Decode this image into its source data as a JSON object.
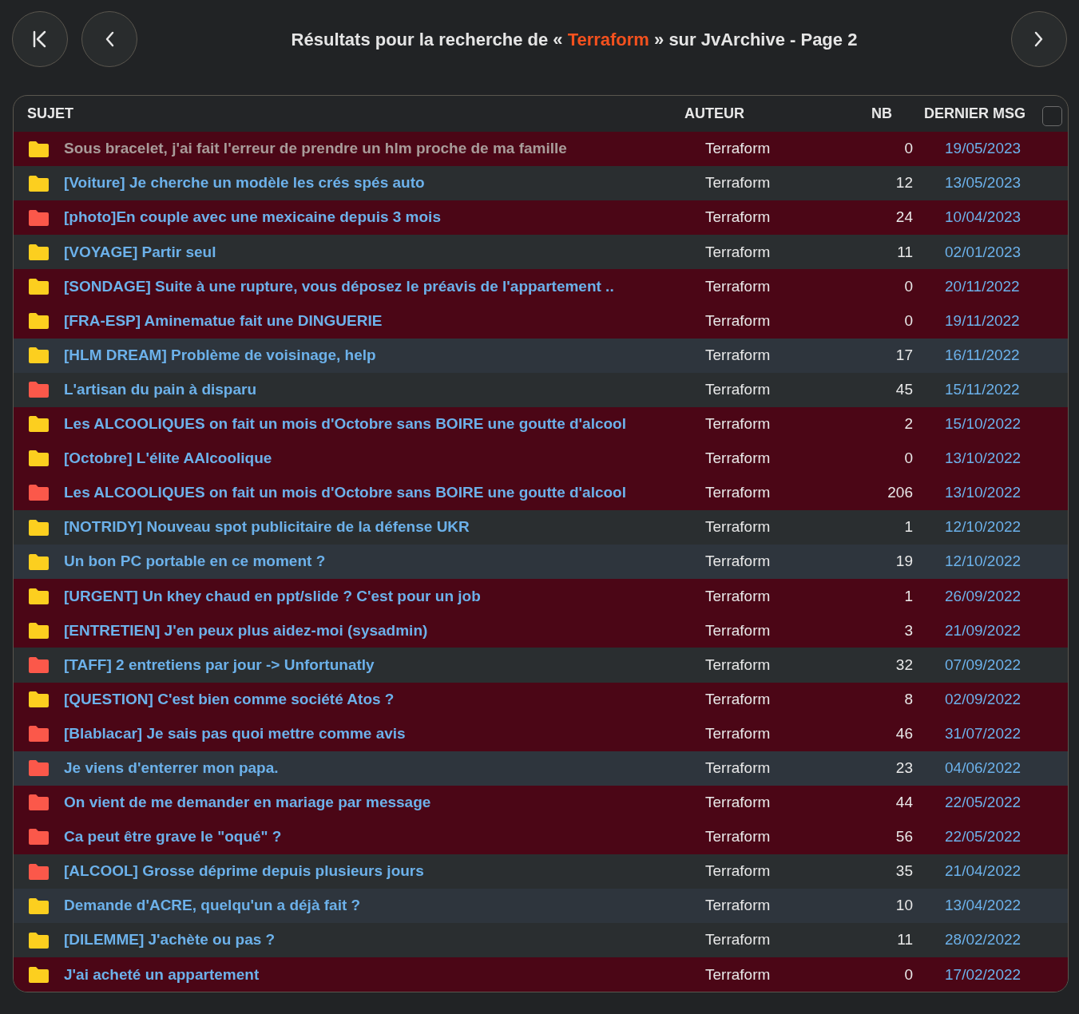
{
  "header": {
    "title_before": "Résultats pour la recherche de « ",
    "query": "Terraform",
    "title_after": " » sur JvArchive - Page 2"
  },
  "table": {
    "columns": [
      "SUJET",
      "AUTEUR",
      "NB",
      "DERNIER MSG"
    ],
    "select_all": {
      "checked": false
    },
    "rows": [
      {
        "kind": "normal",
        "title": "Sous bracelet, j'ai fait l'erreur de prendre un hlm proche de ma famille",
        "visited": true,
        "deleted": true,
        "author": "Terraform",
        "nb": "0",
        "date": "19/05/2023"
      },
      {
        "kind": "normal",
        "title": "[Voiture] Je cherche un modèle les crés spés auto",
        "visited": false,
        "deleted": false,
        "author": "Terraform",
        "nb": "12",
        "date": "13/05/2023"
      },
      {
        "kind": "hot",
        "title": "[photo]En couple avec une mexicaine depuis 3 mois",
        "visited": false,
        "deleted": true,
        "author": "Terraform",
        "nb": "24",
        "date": "10/04/2023"
      },
      {
        "kind": "normal",
        "title": "[VOYAGE] Partir seul",
        "visited": false,
        "deleted": false,
        "author": "Terraform",
        "nb": "11",
        "date": "02/01/2023"
      },
      {
        "kind": "normal",
        "title": "[SONDAGE] Suite à une rupture, vous déposez le préavis de l'appartement ..",
        "visited": false,
        "deleted": true,
        "author": "Terraform",
        "nb": "0",
        "date": "20/11/2022"
      },
      {
        "kind": "normal",
        "title": "[FRA-ESP] Aminematue fait une DINGUERIE",
        "visited": false,
        "deleted": true,
        "author": "Terraform",
        "nb": "0",
        "date": "19/11/2022"
      },
      {
        "kind": "normal",
        "title": "[HLM DREAM] Problème de voisinage, help",
        "visited": false,
        "deleted": false,
        "author": "Terraform",
        "nb": "17",
        "date": "16/11/2022"
      },
      {
        "kind": "hot",
        "title": "L'artisan du pain à disparu",
        "visited": false,
        "deleted": false,
        "author": "Terraform",
        "nb": "45",
        "date": "15/11/2022"
      },
      {
        "kind": "normal",
        "title": "Les ALCOOLIQUES on fait un mois d'Octobre sans BOIRE une goutte d'alcool",
        "visited": false,
        "deleted": true,
        "author": "Terraform",
        "nb": "2",
        "date": "15/10/2022"
      },
      {
        "kind": "normal",
        "title": "[Octobre] L'élite AAlcoolique",
        "visited": false,
        "deleted": true,
        "author": "Terraform",
        "nb": "0",
        "date": "13/10/2022"
      },
      {
        "kind": "hot",
        "title": "Les ALCOOLIQUES on fait un mois d'Octobre sans BOIRE une goutte d'alcool",
        "visited": false,
        "deleted": true,
        "author": "Terraform",
        "nb": "206",
        "date": "13/10/2022"
      },
      {
        "kind": "normal",
        "title": "[NOTRIDY] Nouveau spot publicitaire de la défense UKR",
        "visited": false,
        "deleted": false,
        "author": "Terraform",
        "nb": "1",
        "date": "12/10/2022"
      },
      {
        "kind": "normal",
        "title": "Un bon PC portable en ce moment ?",
        "visited": false,
        "deleted": false,
        "author": "Terraform",
        "nb": "19",
        "date": "12/10/2022"
      },
      {
        "kind": "normal",
        "title": "[URGENT] Un khey chaud en ppt/slide ? C'est pour un job",
        "visited": false,
        "deleted": true,
        "author": "Terraform",
        "nb": "1",
        "date": "26/09/2022"
      },
      {
        "kind": "normal",
        "title": "[ENTRETIEN] J'en peux plus aidez-moi (sysadmin)",
        "visited": false,
        "deleted": true,
        "author": "Terraform",
        "nb": "3",
        "date": "21/09/2022"
      },
      {
        "kind": "hot",
        "title": "[TAFF] 2 entretiens par jour -> Unfortunatly",
        "visited": false,
        "deleted": false,
        "author": "Terraform",
        "nb": "32",
        "date": "07/09/2022"
      },
      {
        "kind": "normal",
        "title": "[QUESTION] C'est bien comme société Atos ?",
        "visited": false,
        "deleted": true,
        "author": "Terraform",
        "nb": "8",
        "date": "02/09/2022"
      },
      {
        "kind": "hot",
        "title": "[Blablacar] Je sais pas quoi mettre comme avis",
        "visited": false,
        "deleted": true,
        "author": "Terraform",
        "nb": "46",
        "date": "31/07/2022"
      },
      {
        "kind": "hot",
        "title": "Je viens d'enterrer mon papa.",
        "visited": false,
        "deleted": false,
        "author": "Terraform",
        "nb": "23",
        "date": "04/06/2022"
      },
      {
        "kind": "hot",
        "title": "On vient de me demander en mariage par message",
        "visited": false,
        "deleted": true,
        "author": "Terraform",
        "nb": "44",
        "date": "22/05/2022"
      },
      {
        "kind": "hot",
        "title": "Ca peut être grave le \"oqué\" ?",
        "visited": false,
        "deleted": true,
        "author": "Terraform",
        "nb": "56",
        "date": "22/05/2022"
      },
      {
        "kind": "hot",
        "title": "[ALCOOL] Grosse déprime depuis plusieurs jours",
        "visited": false,
        "deleted": false,
        "author": "Terraform",
        "nb": "35",
        "date": "21/04/2022"
      },
      {
        "kind": "normal",
        "title": "Demande d'ACRE, quelqu'un a déjà fait ?",
        "visited": false,
        "deleted": false,
        "author": "Terraform",
        "nb": "10",
        "date": "13/04/2022"
      },
      {
        "kind": "normal",
        "title": "[DILEMME] J'achète ou pas ?",
        "visited": false,
        "deleted": false,
        "author": "Terraform",
        "nb": "11",
        "date": "28/02/2022"
      },
      {
        "kind": "normal",
        "title": "J'ai acheté un appartement",
        "visited": false,
        "deleted": true,
        "author": "Terraform",
        "nb": "0",
        "date": "17/02/2022"
      }
    ]
  }
}
